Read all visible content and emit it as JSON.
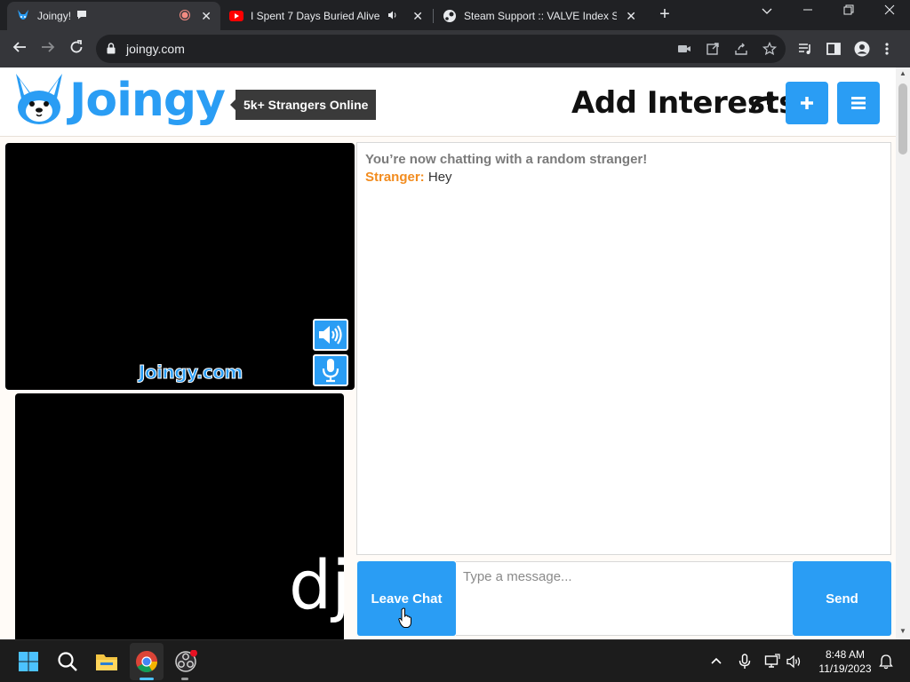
{
  "browser": {
    "tabs": [
      {
        "title": "Joingy!",
        "active": true
      },
      {
        "title": "I Spent 7 Days Buried Alive -",
        "active": false
      },
      {
        "title": "Steam Support :: VALVE Index Sys",
        "active": false
      }
    ],
    "url": "joingy.com",
    "icons": [
      "back-icon",
      "forward-icon",
      "reload-icon",
      "lock-icon",
      "camera-icon",
      "open-external-icon",
      "share-icon",
      "star-icon",
      "media-queue-icon",
      "sidebar-icon",
      "profile-icon",
      "menu-icon"
    ]
  },
  "site": {
    "logo_text": "Joingy",
    "online_badge": "5k+ Strangers Online",
    "interests_label": "Add Interests",
    "add_button": "+",
    "menu_button": "≡",
    "brand_color": "#2a9df4",
    "accent_color": "#f28c1f"
  },
  "video": {
    "watermark": "Joingy.com",
    "self_overlay_text": "dj"
  },
  "chat": {
    "system_message": "You’re now chatting with a random stranger!",
    "messages": [
      {
        "sender": "Stranger:",
        "text": " Hey"
      }
    ],
    "input_placeholder": "Type a message...",
    "leave_label": "Leave Chat",
    "send_label": "Send"
  },
  "taskbar": {
    "time": "8:48 AM",
    "date": "11/19/2023"
  }
}
